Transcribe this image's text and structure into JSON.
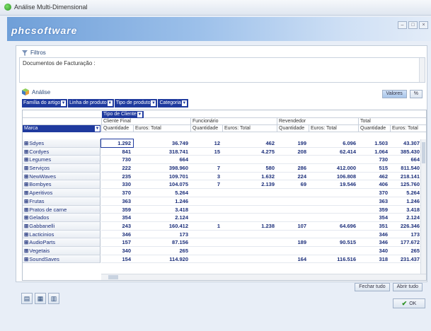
{
  "window": {
    "title": "Análise Multi-Dimensional"
  },
  "banner": {
    "logo_text": "phcsoftware"
  },
  "filtros": {
    "title": "Filtros",
    "text": "Documentos de Facturação :"
  },
  "analise": {
    "title": "Análise",
    "buttons": [
      "Valores",
      "%"
    ],
    "dimensions": [
      "Família do artigo",
      "Linha de produto",
      "Tipo de produto",
      "Categoria"
    ]
  },
  "grid": {
    "column_dimension": "Tipo de Cliente",
    "row_dimension": "Marca",
    "groups": [
      "Cliente Final",
      "Funcionário",
      "Revendedor",
      "Total"
    ],
    "measures": [
      "Quantidade",
      "Euros: Total"
    ],
    "rows": [
      {
        "label": "Sdyes",
        "values": [
          "1.292",
          "36.749",
          "12",
          "462",
          "199",
          "6.096",
          "1.503",
          "43.307"
        ]
      },
      {
        "label": "Cordyes",
        "values": [
          "841",
          "318.741",
          "15",
          "4.275",
          "208",
          "62.414",
          "1.064",
          "385.430"
        ]
      },
      {
        "label": "Legumes",
        "values": [
          "730",
          "664",
          "",
          "",
          "",
          "",
          "730",
          "664"
        ]
      },
      {
        "label": "Serviços",
        "values": [
          "222",
          "398.960",
          "7",
          "580",
          "286",
          "412.000",
          "515",
          "811.540"
        ]
      },
      {
        "label": "NewWaves",
        "values": [
          "235",
          "109.701",
          "3",
          "1.632",
          "224",
          "106.808",
          "462",
          "218.141"
        ]
      },
      {
        "label": "Bombyes",
        "values": [
          "330",
          "104.075",
          "7",
          "2.139",
          "69",
          "19.546",
          "406",
          "125.760"
        ]
      },
      {
        "label": "Aperitivos",
        "values": [
          "370",
          "5.264",
          "",
          "",
          "",
          "",
          "370",
          "5.264"
        ]
      },
      {
        "label": "Frutas",
        "values": [
          "363",
          "1.246",
          "",
          "",
          "",
          "",
          "363",
          "1.246"
        ]
      },
      {
        "label": "Pratos de carne",
        "values": [
          "359",
          "3.418",
          "",
          "",
          "",
          "",
          "359",
          "3.418"
        ]
      },
      {
        "label": "Gelados",
        "values": [
          "354",
          "2.124",
          "",
          "",
          "",
          "",
          "354",
          "2.124"
        ]
      },
      {
        "label": "Gabbanelli",
        "values": [
          "243",
          "160.412",
          "1",
          "1.238",
          "107",
          "64.696",
          "351",
          "226.346"
        ]
      },
      {
        "label": "Lacticinios",
        "values": [
          "346",
          "173",
          "",
          "",
          "",
          "",
          "346",
          "173"
        ]
      },
      {
        "label": "AudioParts",
        "values": [
          "157",
          "87.156",
          "",
          "",
          "189",
          "90.515",
          "346",
          "177.672"
        ]
      },
      {
        "label": "Vegetais",
        "values": [
          "340",
          "265",
          "",
          "",
          "",
          "",
          "340",
          "265"
        ]
      },
      {
        "label": "SoundSaves",
        "values": [
          "154",
          "114.920",
          "",
          "",
          "164",
          "116.516",
          "318",
          "231.437"
        ]
      }
    ]
  },
  "actions": {
    "collapse_all": "Fechar tudo",
    "expand_all": "Abrir tudo",
    "ok": "OK"
  }
}
